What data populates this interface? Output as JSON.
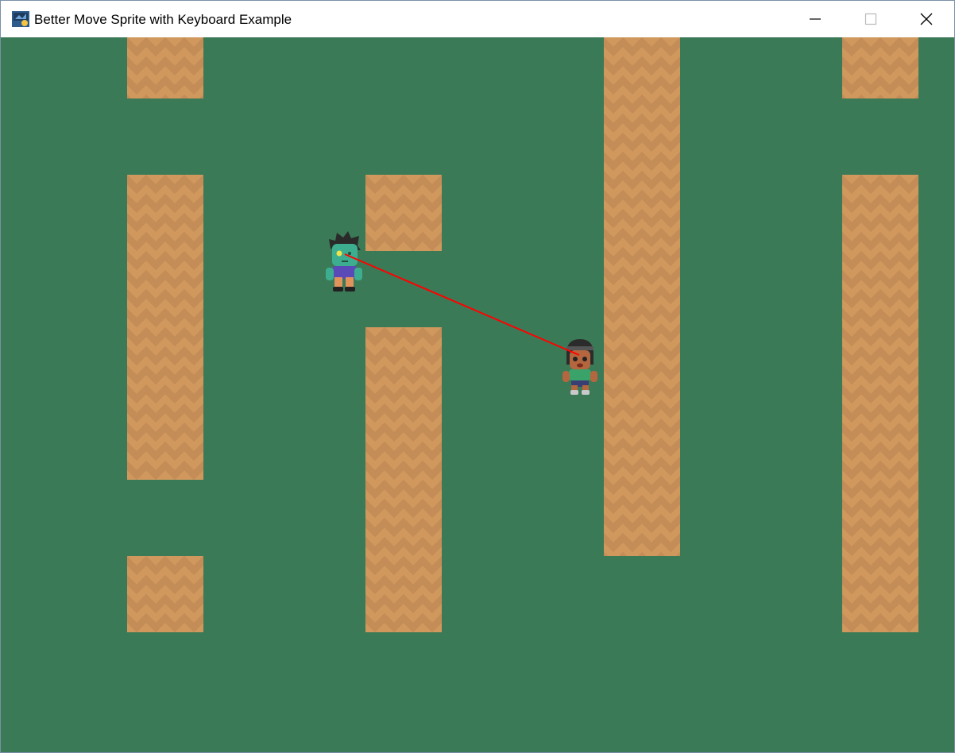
{
  "window": {
    "title": "Better Move Sprite with Keyboard Example",
    "icon": "python-arcade-icon",
    "controls": [
      "minimize-icon",
      "maximize-icon",
      "close-icon"
    ]
  },
  "game": {
    "background_color": "#3b7a57",
    "wall_color": "#c48d57",
    "sight_line_color": "#ff0000",
    "walls": [
      {
        "name": "wall-top-left-block"
      },
      {
        "name": "wall-left-tall"
      },
      {
        "name": "wall-left-bottom-block"
      },
      {
        "name": "wall-center-small"
      },
      {
        "name": "wall-center-tall"
      },
      {
        "name": "wall-right-center-tall"
      },
      {
        "name": "wall-right-top-block"
      },
      {
        "name": "wall-right-tall"
      }
    ],
    "sprites": {
      "player": "zombie-character-sprite",
      "enemy": "female-character-sprite"
    }
  }
}
